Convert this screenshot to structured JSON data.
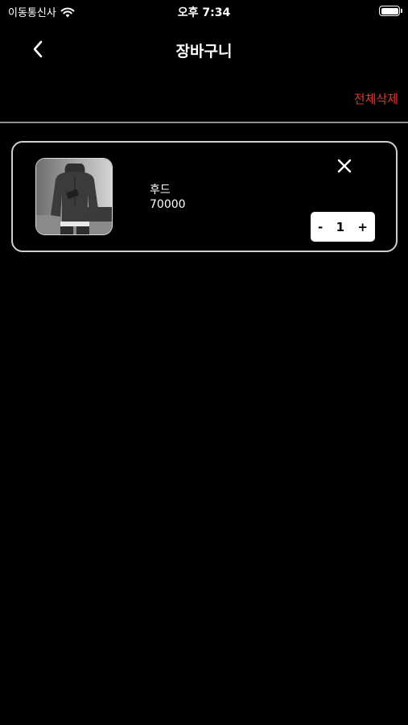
{
  "status_bar": {
    "carrier": "이동통신사",
    "time": "오후 7:34",
    "icons": {
      "wifi": "wifi-icon",
      "battery": "battery-icon"
    }
  },
  "header": {
    "title": "장바구니",
    "back_icon": "chevron-left-icon"
  },
  "actions": {
    "delete_all": "전체삭제"
  },
  "cart": {
    "items": [
      {
        "name": "후드",
        "price": "70000",
        "quantity": "1",
        "decrement": "-",
        "increment": "+",
        "remove_icon": "close-icon",
        "image": "hoodie-photo"
      }
    ]
  },
  "colors": {
    "background": "#000000",
    "accent_delete": "#e0362e",
    "card_border": "#cfcfcf",
    "divider": "#8e8e8e"
  }
}
